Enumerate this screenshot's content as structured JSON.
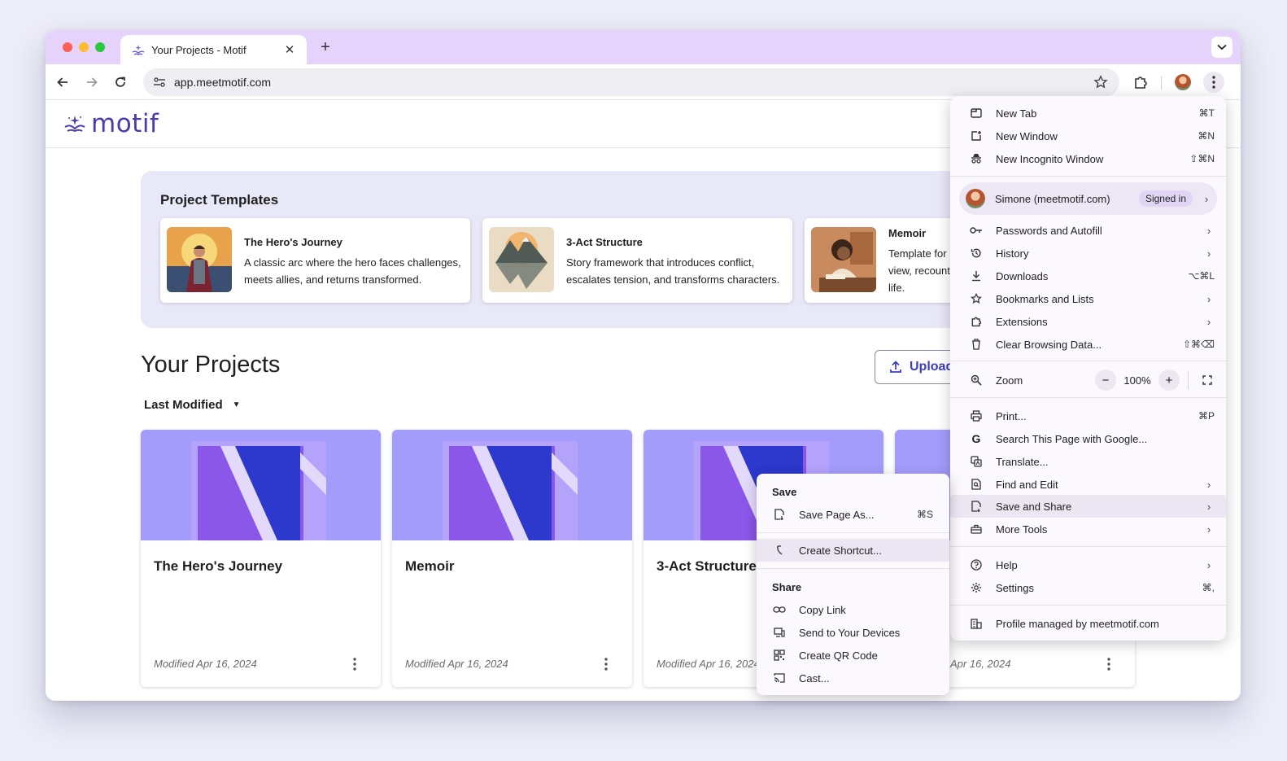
{
  "browser": {
    "tab_title": "Your Projects - Motif",
    "url": "app.meetmotif.com"
  },
  "site": {
    "logo_text": "motif",
    "brand_color": "#4b3bb0"
  },
  "templates": {
    "title": "Project Templates",
    "items": [
      {
        "name": "The Hero's Journey",
        "description": "A classic arc where the hero faces challenges, meets allies, and returns transformed."
      },
      {
        "name": "3-Act Structure",
        "description": "Story framework that introduces conflict, escalates tension, and transforms characters."
      },
      {
        "name": "Memoir",
        "description": "Template for view, recount life."
      }
    ]
  },
  "projects": {
    "title": "Your Projects",
    "upload_label": "Upload",
    "sort_label": "Last Modified",
    "items": [
      {
        "name": "The Hero's Journey",
        "modified": "Modified Apr 16, 2024"
      },
      {
        "name": "Memoir",
        "modified": "Modified Apr 16, 2024"
      },
      {
        "name": "3-Act Structure",
        "modified": "Modified Apr 16, 2024"
      },
      {
        "name": "",
        "modified": "Apr 16, 2024"
      }
    ]
  },
  "chrome_menu": {
    "new_tab": {
      "label": "New Tab",
      "shortcut": "⌘T"
    },
    "new_window": {
      "label": "New Window",
      "shortcut": "⌘N"
    },
    "new_incognito": {
      "label": "New Incognito Window",
      "shortcut": "⇧⌘N"
    },
    "profile": {
      "name": "Simone (meetmotif.com)",
      "badge": "Signed in"
    },
    "passwords": {
      "label": "Passwords and Autofill"
    },
    "history": {
      "label": "History"
    },
    "downloads": {
      "label": "Downloads",
      "shortcut": "⌥⌘L"
    },
    "bookmarks": {
      "label": "Bookmarks and Lists"
    },
    "extensions": {
      "label": "Extensions"
    },
    "clear_data": {
      "label": "Clear Browsing Data...",
      "shortcut": "⇧⌘⌫"
    },
    "zoom": {
      "label": "Zoom",
      "value": "100%",
      "minus": "−",
      "plus": "+"
    },
    "print": {
      "label": "Print...",
      "shortcut": "⌘P"
    },
    "search_google": {
      "label": "Search This Page with Google..."
    },
    "translate": {
      "label": "Translate..."
    },
    "find_edit": {
      "label": "Find and Edit"
    },
    "save_share": {
      "label": "Save and Share"
    },
    "more_tools": {
      "label": "More Tools"
    },
    "help": {
      "label": "Help"
    },
    "settings": {
      "label": "Settings",
      "shortcut": "⌘,"
    },
    "managed": {
      "label": "Profile managed by meetmotif.com"
    }
  },
  "save_share_menu": {
    "save_heading": "Save",
    "save_page": {
      "label": "Save Page As...",
      "shortcut": "⌘S"
    },
    "create_shortcut": {
      "label": "Create Shortcut..."
    },
    "share_heading": "Share",
    "copy_link": {
      "label": "Copy Link"
    },
    "send_devices": {
      "label": "Send to Your Devices"
    },
    "qr_code": {
      "label": "Create QR Code"
    },
    "cast": {
      "label": "Cast..."
    }
  }
}
